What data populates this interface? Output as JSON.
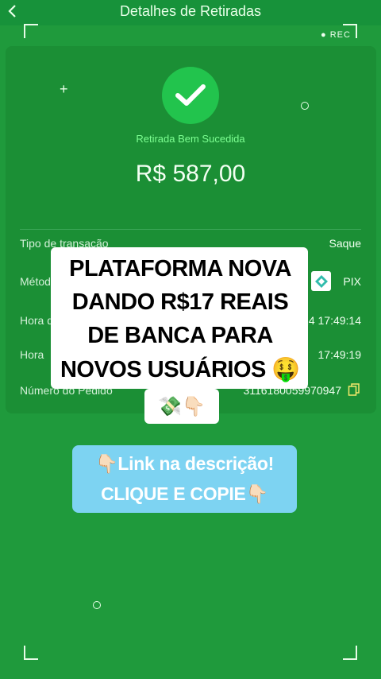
{
  "header": {
    "title": "Detalhes de Retiradas",
    "back_icon": "chevron-left-icon"
  },
  "camera_overlay": {
    "rec_label": "REC"
  },
  "receipt": {
    "status": "Retirada Bem Sucedida",
    "amount": "R$ 587,00",
    "rows": [
      {
        "label": "Tipo de transação",
        "value": "Saque"
      },
      {
        "label": "Métod",
        "value": "PIX"
      },
      {
        "label": "Hora d",
        "value": "2024 17:49:14"
      },
      {
        "label": "Hora",
        "value": "17:49:19"
      },
      {
        "label": "Número do Pedido",
        "value": "3116180059970947"
      }
    ]
  },
  "promo": {
    "lines": [
      "PLATAFORMA NOVA",
      "DANDO R$17 REAIS",
      "DE BANCA PARA",
      "NOVOS USUÁRIOS 🤑"
    ],
    "emoji_line": "💸👇🏻"
  },
  "cta": {
    "line1": "👇🏻Link na descrição!",
    "line2": "CLIQUE E COPIE👇🏻"
  },
  "colors": {
    "background": "#1f9a3c",
    "card": "#1b8f35",
    "success": "#22c44d",
    "cta": "#7dd3f2"
  }
}
